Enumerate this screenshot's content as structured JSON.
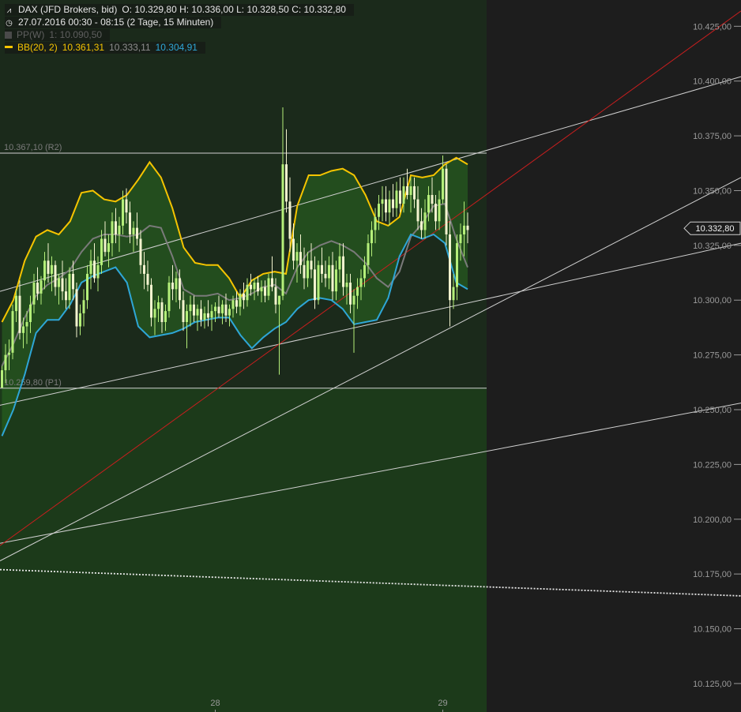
{
  "header": {
    "symbol": "DAX (JFD Brokers, bid)",
    "ohlc": "O: 10.329,80  H: 10.336,00  L: 10.328,50  C: 10.332,80",
    "period": "27.07.2016 00:30 - 08:15 (2 Tage, 15 Minuten)",
    "pp_label": "PP(W)",
    "pp_value": "1: 10.090,50",
    "bb_label": "BB(20, 2)",
    "bb_upper": "10.361,31",
    "bb_mid": "10.333,11",
    "bb_lower": "10.304,91"
  },
  "colors": {
    "plot_area": "#1c3a1a",
    "background": "#1d1d1d",
    "bb_upper": "#f5c400",
    "bb_mid": "#7a7a7a",
    "bb_lower": "#2ea6d6",
    "bb_fill": "#2a6a20",
    "trend_red": "#c81e1e",
    "lines": "#d0d0d0",
    "bull": "#b5ef7a",
    "bear": "#f3f3cf"
  },
  "chart_data": {
    "type": "candlestick",
    "y_axis": {
      "min": 10112,
      "max": 10437,
      "ticks": [
        {
          "value": 10425,
          "label": "10.425,00"
        },
        {
          "value": 10400,
          "label": "10.400,00"
        },
        {
          "value": 10375,
          "label": "10.375,00"
        },
        {
          "value": 10350,
          "label": "10.350,00"
        },
        {
          "value": 10325,
          "label": "10.325,00"
        },
        {
          "value": 10300,
          "label": "10.300,00"
        },
        {
          "value": 10275,
          "label": "10.275,00"
        },
        {
          "value": 10250,
          "label": "10.250,00"
        },
        {
          "value": 10225,
          "label": "10.225,00"
        },
        {
          "value": 10200,
          "label": "10.200,00"
        },
        {
          "value": 10175,
          "label": "10.175,00"
        },
        {
          "value": 10150,
          "label": "10.150,00"
        },
        {
          "value": 10125,
          "label": "10.125,00"
        }
      ]
    },
    "x_axis": {
      "ticks": [
        {
          "bar": 60,
          "label": "28"
        },
        {
          "bar": 124,
          "label": "29"
        }
      ]
    },
    "last_price": {
      "value": 10332.8,
      "label": "10.332,80"
    },
    "levels": [
      {
        "name": "R2",
        "value": 10367.1,
        "label": "10.367,10 (R2)"
      },
      {
        "name": "P1",
        "value": 10259.8,
        "label": "10.259,80 (P1)"
      }
    ],
    "bollinger": {
      "upper": [
        10290,
        10300,
        10318,
        10329,
        10332,
        10330,
        10336,
        10349,
        10350,
        10346,
        10345,
        10348,
        10355,
        10363,
        10356,
        10342,
        10324,
        10317,
        10316,
        10316,
        10310,
        10301,
        10309,
        10312,
        10313,
        10312,
        10343,
        10357,
        10357,
        10359,
        10360,
        10357,
        10348,
        10336,
        10334,
        10338,
        10357,
        10356,
        10357,
        10362,
        10365,
        10362
      ],
      "mid": [
        10270,
        10280,
        10292,
        10302,
        10307,
        10310,
        10314,
        10322,
        10328,
        10330,
        10330,
        10329,
        10330,
        10334,
        10333,
        10320,
        10305,
        10302,
        10302,
        10303,
        10300,
        10301,
        10303,
        10306,
        10307,
        10303,
        10315,
        10322,
        10325,
        10327,
        10325,
        10322,
        10317,
        10310,
        10306,
        10313,
        10329,
        10335,
        10343,
        10344,
        10328,
        10315
      ],
      "lower": [
        10238,
        10250,
        10266,
        10285,
        10291,
        10291,
        10298,
        10308,
        10311,
        10313,
        10315,
        10308,
        10288,
        10283,
        10284,
        10285,
        10287,
        10290,
        10291,
        10292,
        10292,
        10284,
        10278,
        10283,
        10287,
        10290,
        10296,
        10300,
        10301,
        10300,
        10296,
        10289,
        10290,
        10291,
        10301,
        10320,
        10330,
        10328,
        10330,
        10326,
        10308,
        10305
      ]
    },
    "candles": [
      [
        10260,
        10270,
        10262,
        10268
      ],
      [
        10268,
        10280,
        10262,
        10275
      ],
      [
        10275,
        10282,
        10268,
        10276
      ],
      [
        10276,
        10298,
        10273,
        10295
      ],
      [
        10295,
        10305,
        10290,
        10302
      ],
      [
        10302,
        10309,
        10282,
        10285
      ],
      [
        10285,
        10292,
        10278,
        10288
      ],
      [
        10288,
        10295,
        10280,
        10290
      ],
      [
        10290,
        10302,
        10285,
        10298
      ],
      [
        10298,
        10312,
        10294,
        10308
      ],
      [
        10308,
        10315,
        10300,
        10303
      ],
      [
        10303,
        10311,
        10298,
        10309
      ],
      [
        10309,
        10322,
        10305,
        10318
      ],
      [
        10318,
        10326,
        10308,
        10312
      ],
      [
        10312,
        10320,
        10304,
        10316
      ],
      [
        10316,
        10318,
        10302,
        10306
      ],
      [
        10306,
        10312,
        10298,
        10310
      ],
      [
        10310,
        10318,
        10300,
        10304
      ],
      [
        10304,
        10310,
        10296,
        10300
      ],
      [
        10300,
        10315,
        10296,
        10312
      ],
      [
        10312,
        10318,
        10300,
        10305
      ],
      [
        10305,
        10308,
        10283,
        10288
      ],
      [
        10288,
        10298,
        10284,
        10294
      ],
      [
        10294,
        10305,
        10288,
        10300
      ],
      [
        10300,
        10316,
        10296,
        10312
      ],
      [
        10312,
        10323,
        10305,
        10318
      ],
      [
        10318,
        10326,
        10308,
        10310
      ],
      [
        10310,
        10320,
        10304,
        10316
      ],
      [
        10316,
        10332,
        10312,
        10328
      ],
      [
        10328,
        10336,
        10320,
        10322
      ],
      [
        10322,
        10330,
        10315,
        10326
      ],
      [
        10326,
        10340,
        10320,
        10336
      ],
      [
        10336,
        10342,
        10326,
        10330
      ],
      [
        10330,
        10338,
        10322,
        10334
      ],
      [
        10334,
        10350,
        10330,
        10346
      ],
      [
        10346,
        10351,
        10335,
        10340
      ],
      [
        10340,
        10345,
        10326,
        10330
      ],
      [
        10330,
        10336,
        10322,
        10333
      ],
      [
        10333,
        10340,
        10325,
        10328
      ],
      [
        10328,
        10332,
        10312,
        10316
      ],
      [
        10316,
        10322,
        10305,
        10312
      ],
      [
        10312,
        10318,
        10304,
        10307
      ],
      [
        10307,
        10310,
        10288,
        10292
      ],
      [
        10292,
        10300,
        10284,
        10296
      ],
      [
        10296,
        10302,
        10290,
        10299
      ],
      [
        10299,
        10301,
        10285,
        10290
      ],
      [
        10290,
        10298,
        10286,
        10295
      ],
      [
        10295,
        10311,
        10292,
        10308
      ],
      [
        10308,
        10316,
        10300,
        10305
      ],
      [
        10305,
        10313,
        10299,
        10310
      ],
      [
        10310,
        10314,
        10296,
        10300
      ],
      [
        10300,
        10304,
        10286,
        10290
      ],
      [
        10290,
        10298,
        10278,
        10295
      ],
      [
        10295,
        10302,
        10288,
        10298
      ],
      [
        10298,
        10302,
        10290,
        10293
      ],
      [
        10293,
        10298,
        10286,
        10296
      ],
      [
        10296,
        10300,
        10288,
        10291
      ],
      [
        10291,
        10297,
        10287,
        10294
      ],
      [
        10294,
        10300,
        10288,
        10292
      ],
      [
        10292,
        10298,
        10286,
        10295
      ],
      [
        10295,
        10299,
        10290,
        10297
      ],
      [
        10297,
        10302,
        10292,
        10294
      ],
      [
        10294,
        10300,
        10289,
        10298
      ],
      [
        10298,
        10303,
        10290,
        10293
      ],
      [
        10293,
        10298,
        10288,
        10296
      ],
      [
        10296,
        10302,
        10292,
        10300
      ],
      [
        10300,
        10304,
        10294,
        10297
      ],
      [
        10297,
        10305,
        10293,
        10303
      ],
      [
        10303,
        10308,
        10296,
        10300
      ],
      [
        10300,
        10310,
        10297,
        10307
      ],
      [
        10307,
        10312,
        10302,
        10305
      ],
      [
        10305,
        10310,
        10300,
        10308
      ],
      [
        10308,
        10311,
        10302,
        10304
      ],
      [
        10304,
        10309,
        10299,
        10306
      ],
      [
        10306,
        10309,
        10299,
        10302
      ],
      [
        10302,
        10312,
        10300,
        10310
      ],
      [
        10310,
        10320,
        10304,
        10306
      ],
      [
        10306,
        10310,
        10294,
        10298
      ],
      [
        10298,
        10302,
        10266,
        10302
      ],
      [
        10302,
        10388,
        10300,
        10362
      ],
      [
        10362,
        10378,
        10340,
        10345
      ],
      [
        10345,
        10356,
        10322,
        10328
      ],
      [
        10328,
        10335,
        10314,
        10318
      ],
      [
        10318,
        10326,
        10308,
        10322
      ],
      [
        10322,
        10330,
        10312,
        10316
      ],
      [
        10316,
        10324,
        10305,
        10310
      ],
      [
        10310,
        10322,
        10306,
        10318
      ],
      [
        10318,
        10326,
        10310,
        10314
      ],
      [
        10314,
        10320,
        10296,
        10300
      ],
      [
        10300,
        10318,
        10298,
        10316
      ],
      [
        10316,
        10324,
        10308,
        10312
      ],
      [
        10312,
        10318,
        10306,
        10310
      ],
      [
        10310,
        10320,
        10305,
        10316
      ],
      [
        10316,
        10322,
        10300,
        10304
      ],
      [
        10304,
        10318,
        10300,
        10314
      ],
      [
        10314,
        10326,
        10308,
        10320
      ],
      [
        10320,
        10326,
        10302,
        10306
      ],
      [
        10306,
        10312,
        10298,
        10308
      ],
      [
        10308,
        10312,
        10294,
        10298
      ],
      [
        10298,
        10305,
        10276,
        10302
      ],
      [
        10302,
        10310,
        10296,
        10306
      ],
      [
        10306,
        10314,
        10300,
        10310
      ],
      [
        10310,
        10320,
        10306,
        10316
      ],
      [
        10316,
        10330,
        10312,
        10326
      ],
      [
        10326,
        10336,
        10320,
        10332
      ],
      [
        10332,
        10342,
        10326,
        10338
      ],
      [
        10338,
        10348,
        10332,
        10344
      ],
      [
        10344,
        10352,
        10336,
        10346
      ],
      [
        10346,
        10352,
        10336,
        10340
      ],
      [
        10340,
        10350,
        10334,
        10346
      ],
      [
        10346,
        10353,
        10338,
        10342
      ],
      [
        10342,
        10354,
        10338,
        10350
      ],
      [
        10350,
        10356,
        10340,
        10344
      ],
      [
        10344,
        10356,
        10340,
        10352
      ],
      [
        10352,
        10360,
        10346,
        10348
      ],
      [
        10348,
        10356,
        10340,
        10352
      ],
      [
        10352,
        10356,
        10342,
        10346
      ],
      [
        10346,
        10352,
        10332,
        10336
      ],
      [
        10336,
        10342,
        10328,
        10332
      ],
      [
        10332,
        10346,
        10328,
        10340
      ],
      [
        10340,
        10352,
        10336,
        10348
      ],
      [
        10348,
        10356,
        10340,
        10344
      ],
      [
        10344,
        10348,
        10332,
        10336
      ],
      [
        10336,
        10350,
        10332,
        10346
      ],
      [
        10346,
        10366,
        10344,
        10360
      ],
      [
        10360,
        10362,
        10325,
        10330
      ],
      [
        10330,
        10336,
        10288,
        10300
      ],
      [
        10300,
        10312,
        10296,
        10306
      ],
      [
        10306,
        10330,
        10300,
        10326
      ],
      [
        10326,
        10335,
        10318,
        10330
      ],
      [
        10330,
        10345,
        10320,
        10334
      ],
      [
        10334,
        10340,
        10326,
        10332
      ]
    ]
  }
}
